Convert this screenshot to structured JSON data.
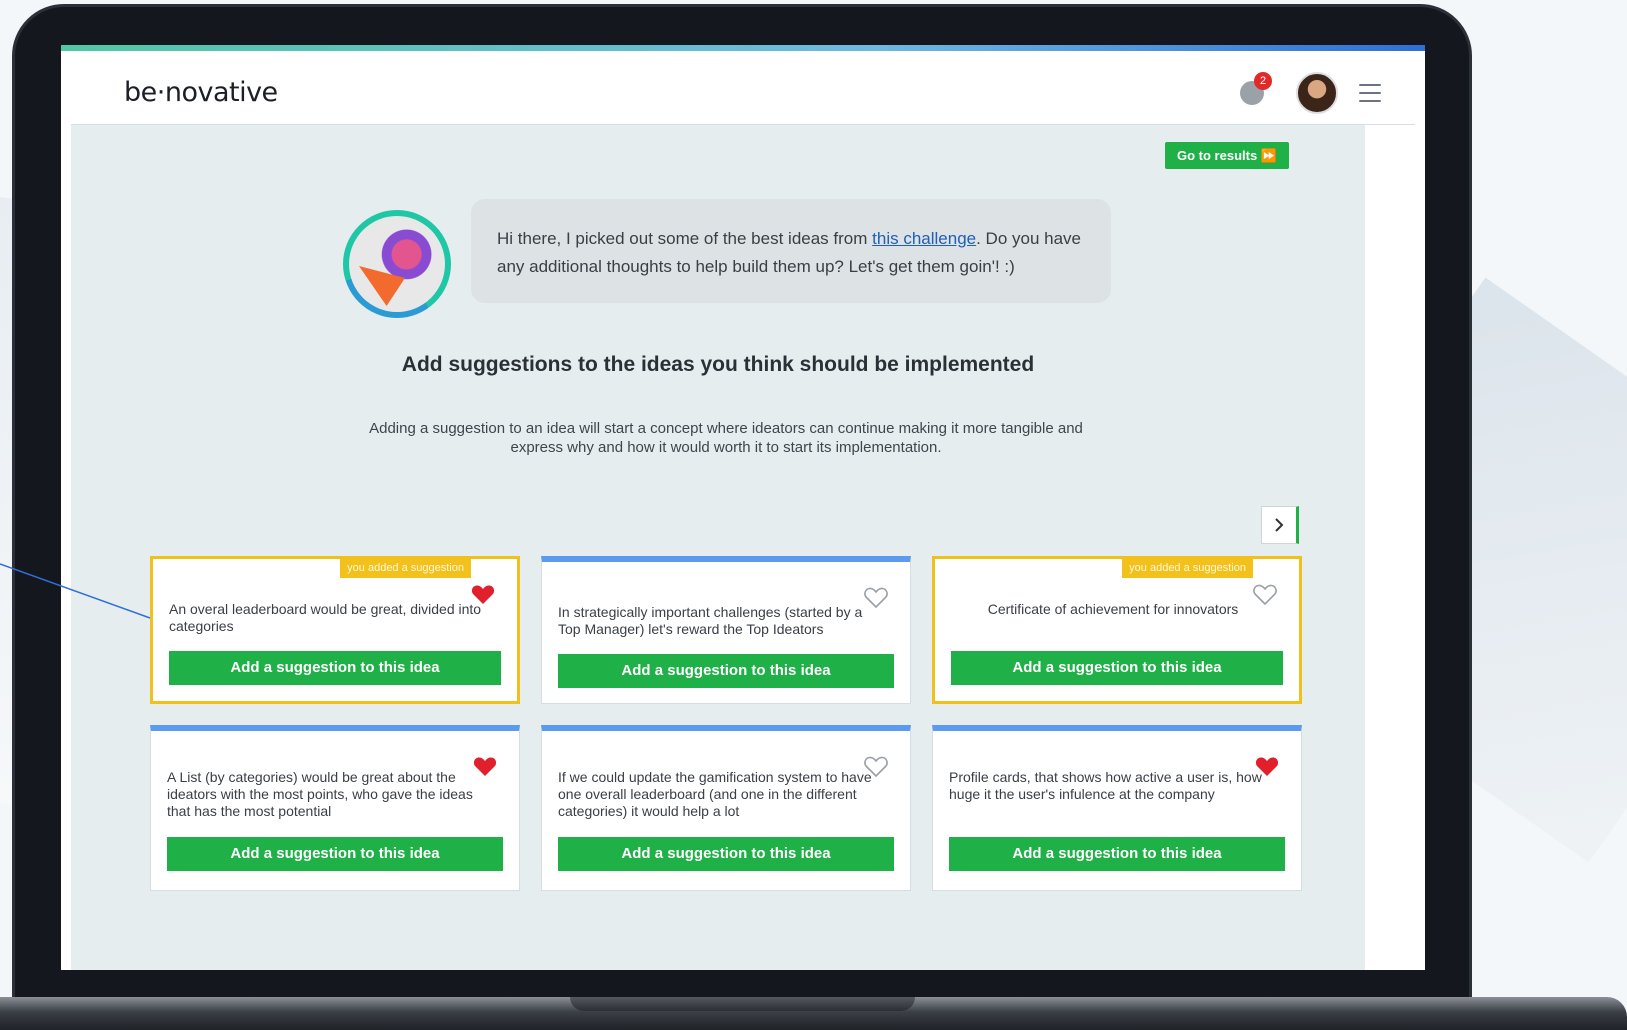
{
  "brand": {
    "logo_text": "be·novative",
    "notification_count": "2"
  },
  "content": {
    "results_button": "Go to results ⏩",
    "bubble_text_before": "Hi there, I picked out some of the best ideas from ",
    "bubble_link": "this challenge",
    "bubble_text_after": ". Do you have any additional thoughts to help build them up? Let's get them goin'! :)",
    "title": "Add suggestions to the ideas you think should be implemented",
    "subtitle": "Adding a suggestion to an idea will start a concept where ideators can continue making it more tangible and express why and how it would worth it to start its implementation."
  },
  "cards": [
    {
      "text": "An overal leaderboard would be great, divided into categories",
      "added_badge": "you added a suggestion",
      "liked": true,
      "button": "Add a suggestion to this idea"
    },
    {
      "text": "In strategically important challenges (started by a Top Manager) let's reward the Top Ideators",
      "added_badge": "",
      "liked": false,
      "button": "Add a suggestion to this idea"
    },
    {
      "text": "Certificate of achievement for innovators",
      "added_badge": "you added a suggestion",
      "liked": false,
      "button": "Add a suggestion to this idea"
    },
    {
      "text": "A List (by categories) would be great about the ideators with the most points, who gave the ideas that has the most potential",
      "added_badge": "",
      "liked": true,
      "button": "Add a suggestion to this idea"
    },
    {
      "text": "If we could update the gamification system to have one overall leaderboard (and one in the different categories) it would help a lot",
      "added_badge": "",
      "liked": false,
      "button": "Add a suggestion to this idea"
    },
    {
      "text": "Profile cards, that shows how active a user is, how huge it the user's infulence at the company",
      "added_badge": "",
      "liked": true,
      "button": "Add a suggestion to this idea"
    }
  ],
  "colors": {
    "accent_green": "#1fb047",
    "added_yellow": "#f0c11c",
    "card_blue": "#5b9bef",
    "heart_red": "#e0202a"
  },
  "icons": {
    "notification": "bell-icon",
    "menu": "hamburger-menu-icon",
    "next": "chevron-right-icon",
    "like": "heart-icon"
  }
}
